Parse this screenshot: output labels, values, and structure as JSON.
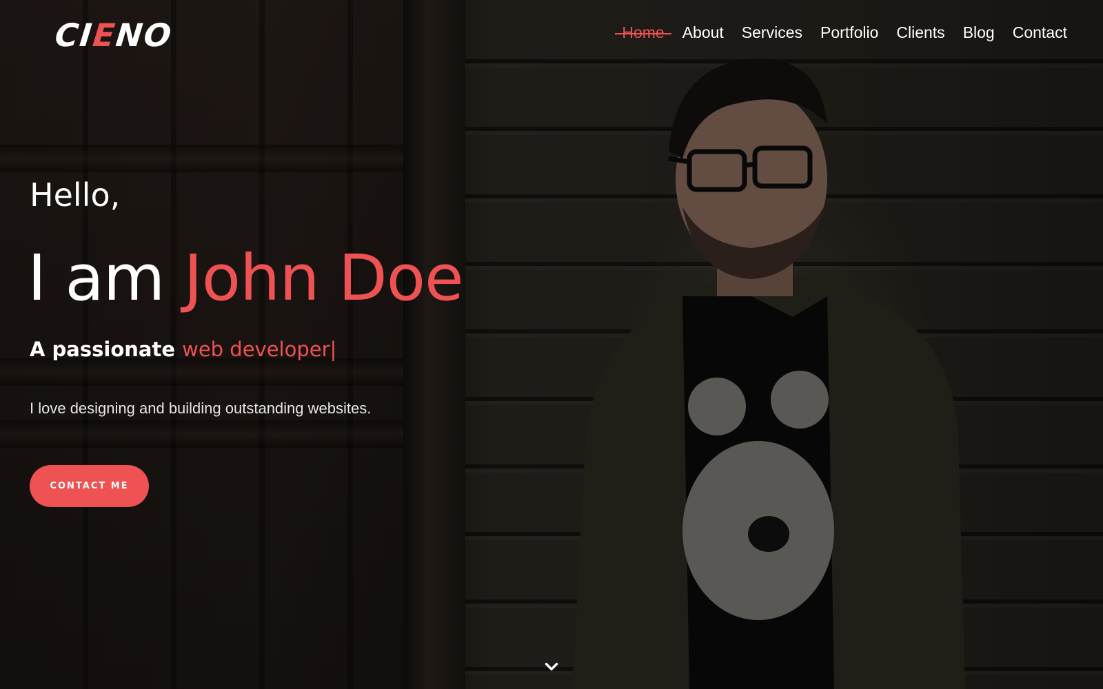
{
  "logo": {
    "parts": [
      "CI",
      "E",
      "N",
      "O"
    ]
  },
  "nav": {
    "items": [
      "Home",
      "About",
      "Services",
      "Portfolio",
      "Clients",
      "Blog",
      "Contact"
    ],
    "active": "Home"
  },
  "hero": {
    "greeting": "Hello,",
    "name_prefix": "I am ",
    "name": "John Doe",
    "tagline_prefix": "A passionate ",
    "tagline_role": "web developer|",
    "description": "I love designing and building outstanding websites.",
    "cta_label": "CONTACT ME",
    "scroll_icon": "chevron-down-icon"
  },
  "colors": {
    "accent": "#ee5253",
    "text": "#ffffff"
  }
}
